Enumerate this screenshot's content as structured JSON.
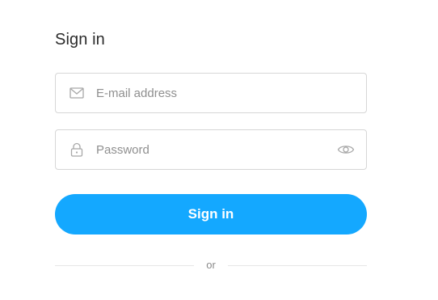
{
  "form": {
    "title": "Sign in",
    "email": {
      "icon": "envelope-icon",
      "placeholder": "E-mail address",
      "value": ""
    },
    "password": {
      "icon": "lock-icon",
      "placeholder": "Password",
      "value": "",
      "toggle_icon": "eye-icon"
    },
    "submit_label": "Sign in",
    "divider_text": "or"
  },
  "colors": {
    "accent": "#14a8ff",
    "border": "#d6d6d6",
    "text": "#2b2b2b",
    "placeholder": "#8f8f8f",
    "icon": "#a8a8a8"
  }
}
